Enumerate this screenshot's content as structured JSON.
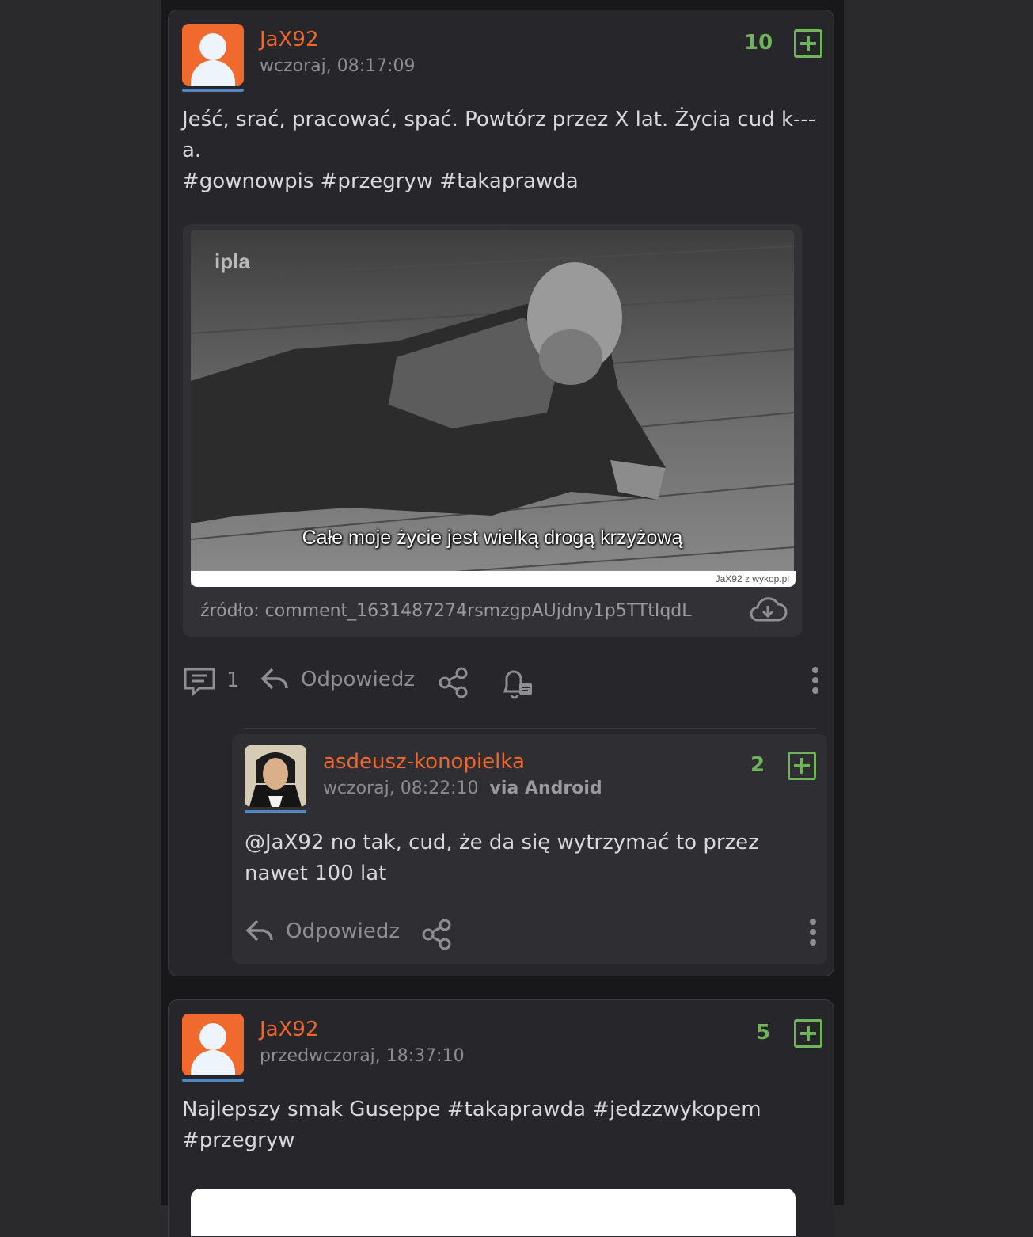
{
  "posts": [
    {
      "username": "JaX92",
      "timestamp": "wczoraj, 08:17:09",
      "score": "10",
      "text": "Jeść, srać, pracować, spać. Powtórz przez X lat. Życia cud k---a.",
      "tags": "#gownowpis #przegryw #takaprawda",
      "embed": {
        "logo": "ipla",
        "caption": "Całe moje życie jest wielką drogą krzyżową",
        "watermark": "JaX92 z wykop.pl",
        "source": "źródło: comment_1631487274rsmzgpAUjdny1p5TTtIqdL"
      },
      "actions": {
        "comments_count": "1",
        "reply_label": "Odpowiedz"
      },
      "icons": [
        "comments-icon",
        "reply-icon",
        "share-icon",
        "bell-icon",
        "more-icon",
        "download-icon",
        "plus-icon"
      ],
      "reply": {
        "username": "asdeusz-konopielka",
        "timestamp": "wczoraj, 08:22:10",
        "via": "via Android",
        "score": "2",
        "text": "@JaX92 no tak, cud, że da się wytrzymać to przez nawet 100 lat",
        "reply_label": "Odpowiedz"
      }
    },
    {
      "username": "JaX92",
      "timestamp": "przedwczoraj, 18:37:10",
      "score": "5",
      "text": "Najlepszy smak Guseppe #takaprawda #jedzzwykopem #przegryw"
    }
  ],
  "colors": {
    "username": "#f0662c",
    "score": "#6fb35a",
    "avatar_bg": "#f06a2e",
    "underline": "#4f86c2"
  }
}
